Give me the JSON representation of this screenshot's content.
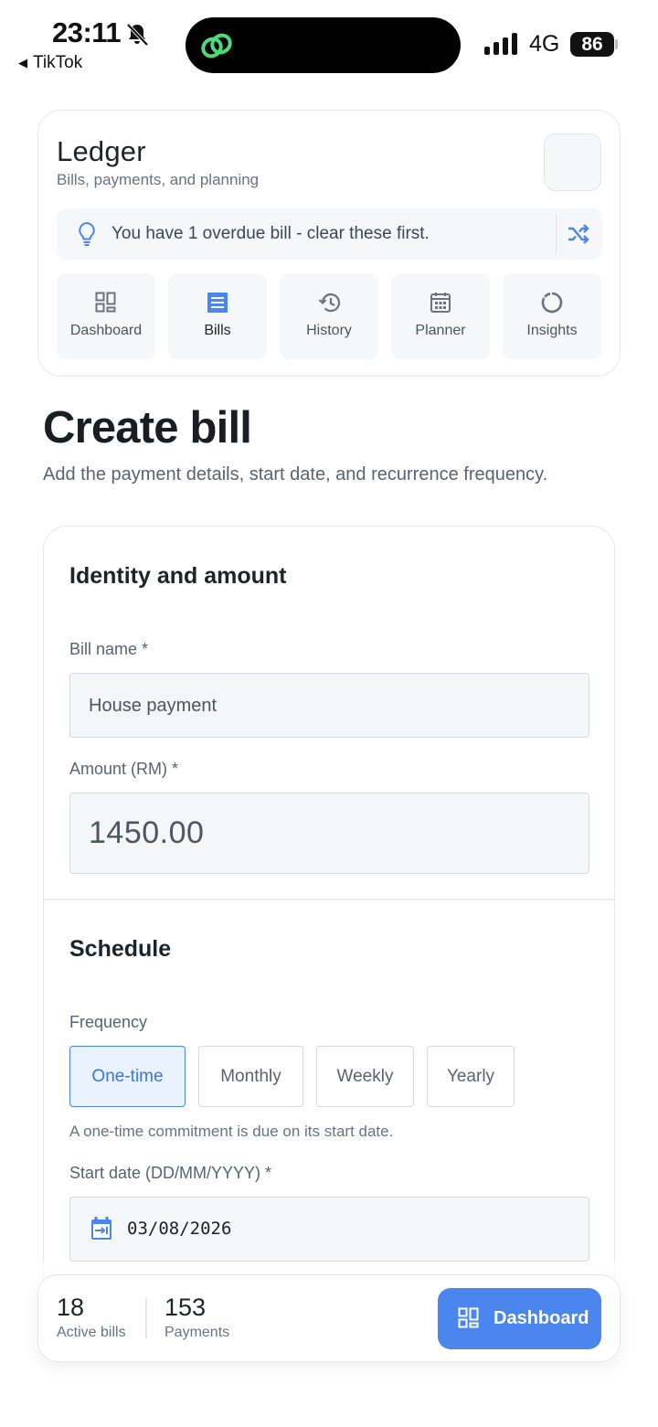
{
  "status_bar": {
    "time": "23:11",
    "back_label": "TikTok",
    "network": "4G",
    "battery": "86"
  },
  "header": {
    "title": "Ledger",
    "subtitle": "Bills, payments, and planning",
    "tip": "You have 1 overdue bill - clear these first.",
    "nav": [
      {
        "label": "Dashboard",
        "icon": "dashboard-icon"
      },
      {
        "label": "Bills",
        "icon": "bills-icon"
      },
      {
        "label": "History",
        "icon": "history-icon"
      },
      {
        "label": "Planner",
        "icon": "calendar-icon"
      },
      {
        "label": "Insights",
        "icon": "insights-icon"
      }
    ],
    "active_nav": "Bills"
  },
  "page": {
    "title": "Create bill",
    "description": "Add the payment details, start date, and recurrence frequency."
  },
  "form": {
    "identity_title": "Identity and amount",
    "bill_name_label": "Bill name *",
    "bill_name_placeholder": "House payment",
    "amount_label": "Amount (RM) *",
    "amount_placeholder": "1450.00",
    "schedule_title": "Schedule",
    "frequency_label": "Frequency",
    "frequency_options": [
      "One-time",
      "Monthly",
      "Weekly",
      "Yearly"
    ],
    "frequency_selected": "One-time",
    "frequency_helper": "A one-time commitment is due on its start date.",
    "start_date_label": "Start date (DD/MM/YYYY) *",
    "start_date_value": "03/08/2026"
  },
  "summary": {
    "active_bills_value": "18",
    "active_bills_label": "Active bills",
    "payments_value": "153",
    "payments_label": "Payments",
    "dashboard_button": "Dashboard"
  },
  "colors": {
    "accent": "#4a86ee",
    "selected_bg": "#eaf2fe",
    "card_border": "#e4e7eb"
  }
}
